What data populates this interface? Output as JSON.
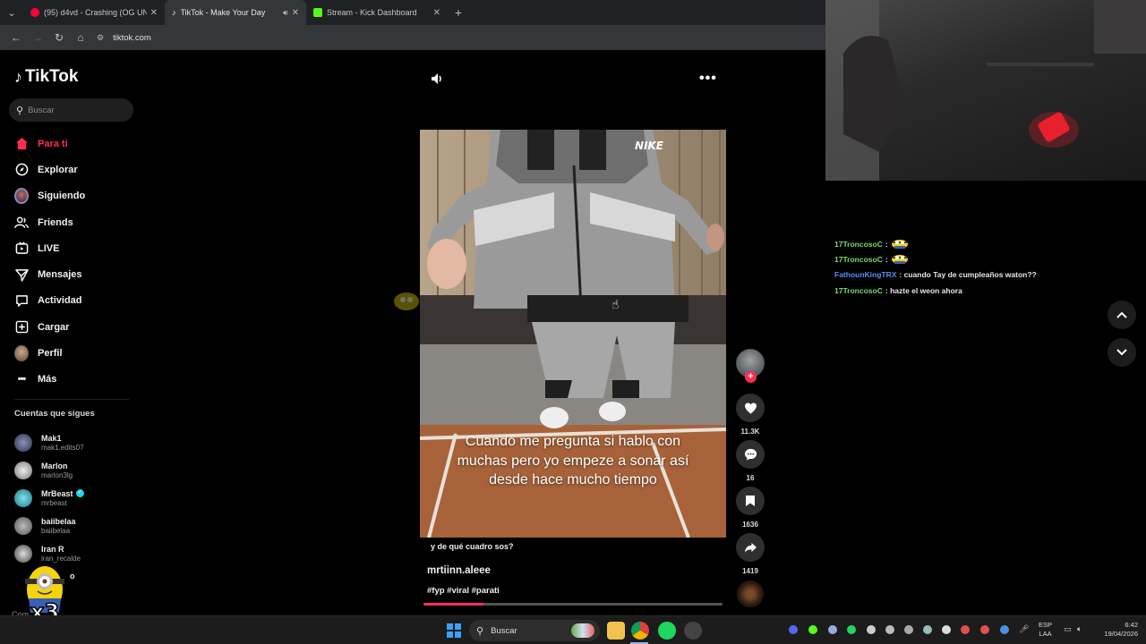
{
  "browser": {
    "tabs": [
      {
        "title": "(95) d4vd - Crashing (OG UNRE",
        "active": false,
        "favicon_color": "#ff0033"
      },
      {
        "title": "TikTok - Make Your Day",
        "active": true,
        "favicon_color": "#ffffff"
      },
      {
        "title": "Stream - Kick Dashboard",
        "active": false,
        "favicon_color": "#53fc18"
      }
    ],
    "url": "tiktok.com"
  },
  "tiktok": {
    "logo": "TikTok",
    "search_placeholder": "Buscar",
    "nav": [
      {
        "label": "Para ti",
        "icon": "home-icon",
        "active": true
      },
      {
        "label": "Explorar",
        "icon": "compass-icon",
        "active": false
      },
      {
        "label": "Siguiendo",
        "icon": "following-avatar-icon",
        "active": false
      },
      {
        "label": "Friends",
        "icon": "friends-icon",
        "active": false
      },
      {
        "label": "LIVE",
        "icon": "live-icon",
        "active": false
      },
      {
        "label": "Mensajes",
        "icon": "messages-icon",
        "active": false
      },
      {
        "label": "Actividad",
        "icon": "activity-icon",
        "active": false
      },
      {
        "label": "Cargar",
        "icon": "upload-icon",
        "active": false
      },
      {
        "label": "Perfil",
        "icon": "profile-avatar-icon",
        "active": false
      },
      {
        "label": "Más",
        "icon": "more-icon",
        "active": false
      }
    ],
    "following_title": "Cuentas que sigues",
    "following": [
      {
        "name": "Mak1",
        "user": "mak1.edits07",
        "verified": false
      },
      {
        "name": "Marlon",
        "user": "marlon3lg",
        "verified": false
      },
      {
        "name": "MrBeast",
        "user": "mrbeast",
        "verified": true
      },
      {
        "name": "baiibelaa",
        "user": "baiibelaa",
        "verified": false
      },
      {
        "name": "Iran R",
        "user": "iran_recalde",
        "verified": false
      }
    ],
    "partial_following_fragment": "o",
    "sticker_text": "x3",
    "bottom_text": "Com",
    "video": {
      "overlay_caption": "Cuando me pregunta si hablo con muchas pero yo empeze a sonar así desde hace mucho tiempo",
      "description": "y de qué cuadro sos?",
      "author": "mrtiinn.aleee",
      "hashtags": "#fyp #viral #parati",
      "progress": 0.2,
      "brand_logo": "NIKE"
    },
    "actions": {
      "likes": "11.3K",
      "comments": "16",
      "saves": "1636",
      "shares": "1419"
    }
  },
  "chat": [
    {
      "user": "17TroncosoC",
      "color": "#7cd86c",
      "text": "",
      "emote": true
    },
    {
      "user": "17TroncosoC",
      "color": "#7cd86c",
      "text": "",
      "emote": true
    },
    {
      "user": "FathounKingTRX",
      "color": "#5a8dee",
      "text": "cuando Tay de cumpleaños waton??",
      "emote": false
    },
    {
      "user": "17TroncosoC",
      "color": "#7cd86c",
      "text": "hazte el weon ahora",
      "emote": false
    }
  ],
  "taskbar": {
    "search_label": "Buscar",
    "lang_line1": "ESP",
    "lang_line2": "LAA",
    "time": "6:42",
    "date": "19/04/2026"
  }
}
